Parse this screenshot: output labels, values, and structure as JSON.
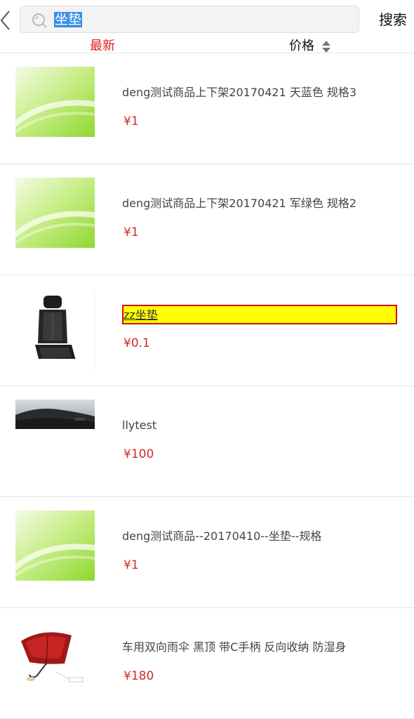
{
  "search": {
    "query": "坐垫",
    "button_label": "搜索"
  },
  "sort": {
    "latest_label": "最新",
    "price_label": "价格"
  },
  "colors": {
    "accent_red": "#e02020",
    "price_red": "#d42a2a",
    "highlight_yellow": "#ffff00"
  },
  "products": [
    {
      "title": "deng测试商品上下架20170421 天蓝色 规格3",
      "price": "¥1",
      "image": "green-placeholder-image"
    },
    {
      "title": "deng测试商品上下架20170421 军绿色 规格2",
      "price": "¥1",
      "image": "green-placeholder-image"
    },
    {
      "title": "zz坐垫",
      "price": "¥0.1",
      "image": "car-seat-cushion-image"
    },
    {
      "title": "llytest",
      "price": "¥100",
      "image": "car-dashboard-image"
    },
    {
      "title": "deng测试商品--20170410--坐垫--规格",
      "price": "¥1",
      "image": "green-placeholder-image"
    },
    {
      "title": "车用双向雨伞 黑顶 带C手柄 反向收纳 防湿身",
      "price": "¥180",
      "image": "red-umbrella-image"
    }
  ]
}
